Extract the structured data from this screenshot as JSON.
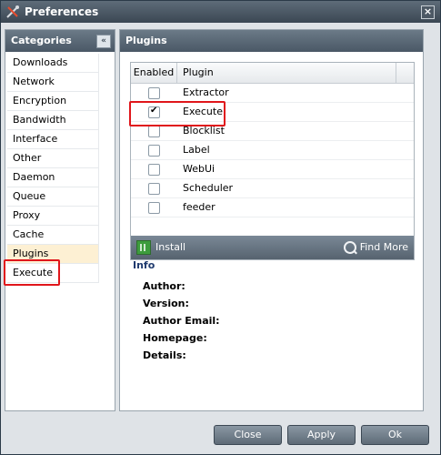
{
  "window": {
    "title": "Preferences",
    "close_label": "×"
  },
  "categories": {
    "header": "Categories",
    "collapse_label": "«",
    "items": [
      {
        "label": "Downloads"
      },
      {
        "label": "Network"
      },
      {
        "label": "Encryption"
      },
      {
        "label": "Bandwidth"
      },
      {
        "label": "Interface"
      },
      {
        "label": "Other"
      },
      {
        "label": "Daemon"
      },
      {
        "label": "Queue"
      },
      {
        "label": "Proxy"
      },
      {
        "label": "Cache"
      },
      {
        "label": "Plugins",
        "selected": true
      },
      {
        "label": "Execute"
      }
    ]
  },
  "plugins": {
    "header": "Plugins",
    "columns": {
      "enabled": "Enabled",
      "plugin": "Plugin"
    },
    "rows": [
      {
        "name": "Extractor",
        "enabled": false
      },
      {
        "name": "Execute",
        "enabled": true
      },
      {
        "name": "Blocklist",
        "enabled": false
      },
      {
        "name": "Label",
        "enabled": false
      },
      {
        "name": "WebUi",
        "enabled": false
      },
      {
        "name": "Scheduler",
        "enabled": false
      },
      {
        "name": "feeder",
        "enabled": false
      }
    ],
    "install_label": "Install",
    "find_more_label": "Find More"
  },
  "info": {
    "title": "Info",
    "fields": [
      "Author:",
      "Version:",
      "Author Email:",
      "Homepage:",
      "Details:"
    ]
  },
  "buttons": {
    "close": "Close",
    "apply": "Apply",
    "ok": "Ok"
  },
  "colors": {
    "highlight": "#e0161b",
    "selected_row": "#fdf0d3",
    "title_bar": "#4a5866"
  }
}
